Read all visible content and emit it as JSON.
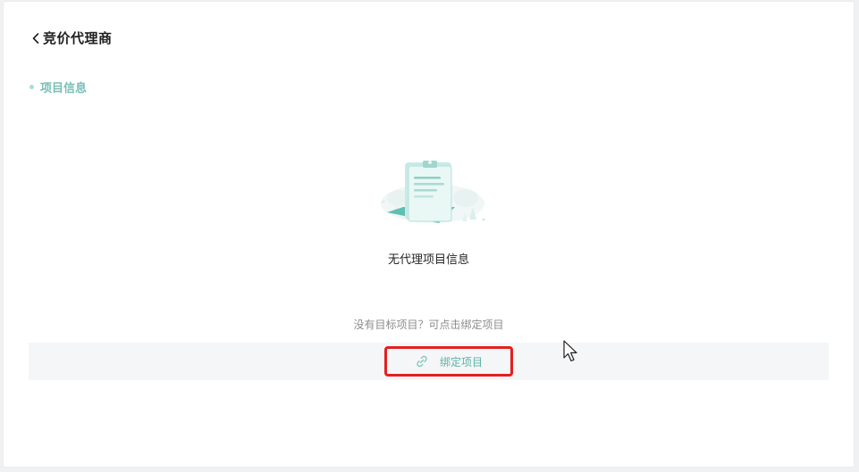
{
  "header": {
    "title": "竞价代理商",
    "back_icon": "chevron-left-icon"
  },
  "section": {
    "title": "项目信息"
  },
  "empty_state": {
    "icon": "clipboard-document-icon",
    "title": "无代理项目信息",
    "hint": "没有目标项目？可点击绑定项目"
  },
  "bind": {
    "label": "绑定项目",
    "icon": "link-icon"
  },
  "colors": {
    "accent": "#5ab3a8",
    "highlight_border": "#e3201f",
    "section_title": "#78bfb6"
  }
}
